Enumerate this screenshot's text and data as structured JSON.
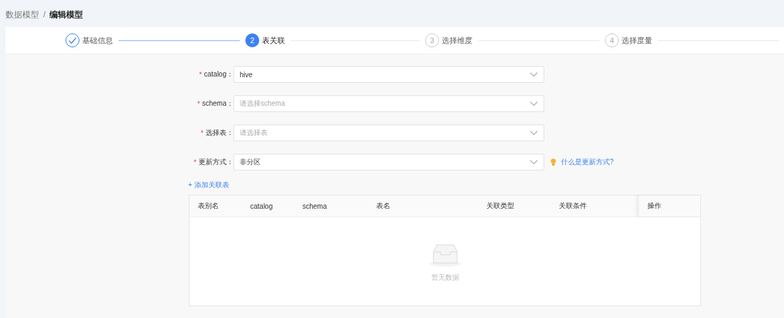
{
  "breadcrumb": [
    {
      "label": "数据模型",
      "current": false
    },
    {
      "label": "编辑模型",
      "current": true
    }
  ],
  "breadcrumb_separator": "/",
  "steps": [
    {
      "label": "基础信息",
      "done": true,
      "selected": false
    },
    {
      "number": "2",
      "label": "表关联",
      "done": false,
      "selected": true
    },
    {
      "number": "3",
      "label": "选择维度",
      "done": false,
      "selected": false
    },
    {
      "number": "4",
      "label": "选择度量",
      "done": false,
      "selected": false
    }
  ],
  "required_mark": "*",
  "form": [
    {
      "label": "catalog：",
      "required": true,
      "value": "hive"
    },
    {
      "label": "schema：",
      "required": true,
      "placeholder": "请选择schema"
    },
    {
      "label": "选择表：",
      "required": true,
      "placeholder": "请选择表"
    },
    {
      "label": "更新方式：",
      "required": true,
      "value": "非分区",
      "help": "什么是更新方式?"
    }
  ],
  "add_link": "+ 添加关联表",
  "table": {
    "columns": [
      "表别名",
      "catalog",
      "schema",
      "表名",
      "关联类型",
      "关联条件",
      "操作"
    ],
    "empty_text": "暂无数据"
  }
}
